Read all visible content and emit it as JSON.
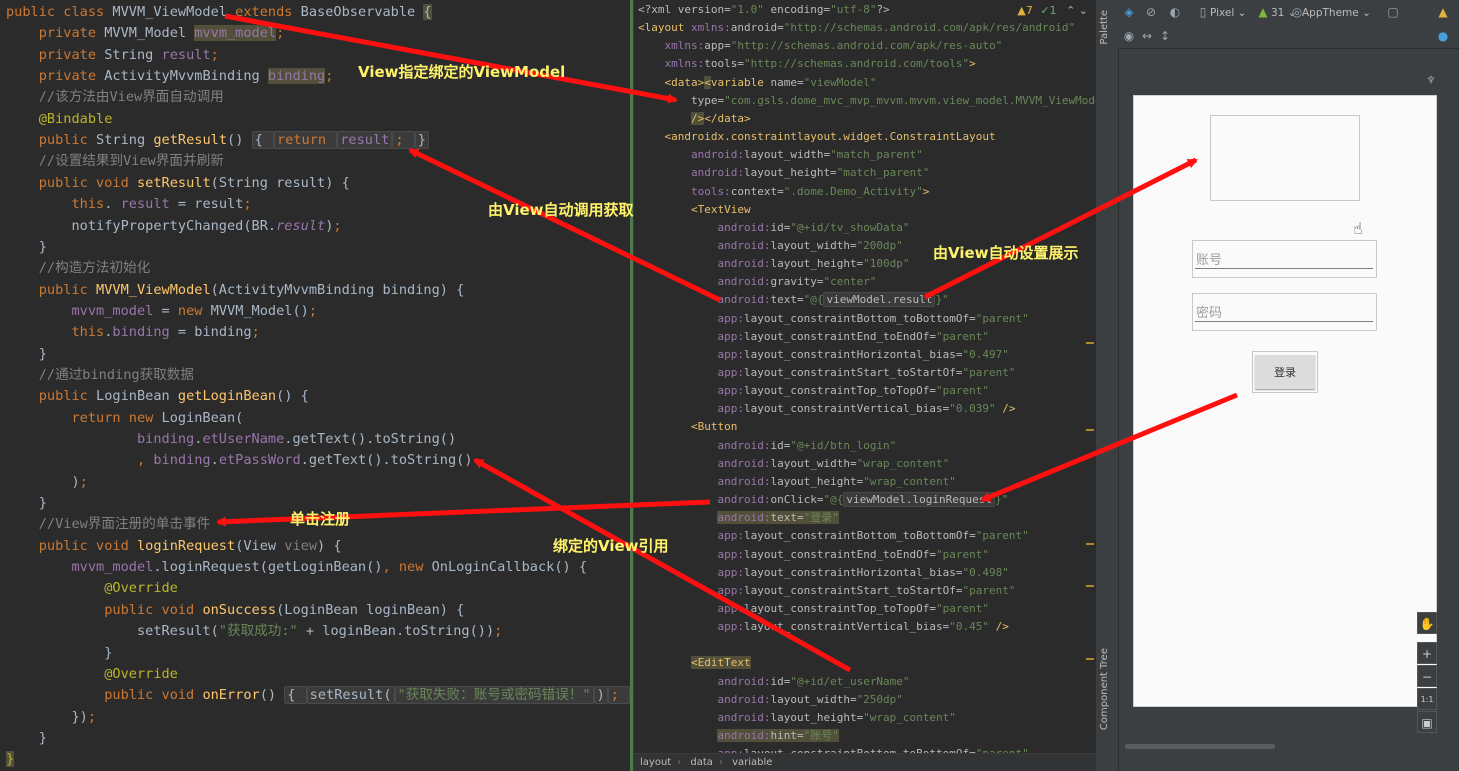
{
  "left_code": [
    [
      [
        "kw",
        "public class "
      ],
      [
        "",
        "MVVM_ViewModel "
      ],
      [
        "kw",
        "extends "
      ],
      [
        "",
        "BaseObservable "
      ],
      [
        "hly",
        "{"
      ]
    ],
    [
      [
        "",
        "    "
      ],
      [
        "kw",
        "private "
      ],
      [
        "",
        "MVVM_Model "
      ],
      [
        "fld hly",
        "mvvm_model"
      ],
      [
        "kw",
        ";"
      ]
    ],
    [
      [
        "",
        "    "
      ],
      [
        "kw",
        "private "
      ],
      [
        "",
        "String "
      ],
      [
        "fld",
        "result"
      ],
      [
        "kw",
        ";"
      ]
    ],
    [
      [
        "",
        "    "
      ],
      [
        "kw",
        "private "
      ],
      [
        "",
        "ActivityMvvmBinding "
      ],
      [
        "fld hly",
        "binding"
      ],
      [
        "kw",
        ";"
      ]
    ],
    [
      [
        "cmt",
        "    //该方法由View界面自动调用"
      ]
    ],
    [
      [
        "ann",
        "    @Bindable"
      ]
    ],
    [
      [
        "",
        "    "
      ],
      [
        "kw",
        "public "
      ],
      [
        "",
        "String "
      ],
      [
        "fn",
        "getResult"
      ],
      [
        "",
        "() "
      ],
      [
        "fold",
        "{ "
      ],
      [
        "kw fold",
        "return "
      ],
      [
        "fld fold",
        "result"
      ],
      [
        "kw fold",
        "; "
      ],
      [
        "fold",
        "}"
      ]
    ],
    [
      [
        "cmt",
        "    //设置结果到View界面并刷新"
      ]
    ],
    [
      [
        "",
        "    "
      ],
      [
        "kw",
        "public void "
      ],
      [
        "fn",
        "setResult"
      ],
      [
        "",
        "(String result) {"
      ]
    ],
    [
      [
        "",
        "        "
      ],
      [
        "kw",
        "this"
      ],
      [
        "",
        ". "
      ],
      [
        "fld",
        "result"
      ],
      [
        "",
        " = result"
      ],
      [
        "kw",
        ";"
      ]
    ],
    [
      [
        "",
        "        notifyPropertyChanged(BR."
      ],
      [
        "fld it",
        "result"
      ],
      [
        "",
        ")"
      ],
      [
        "kw",
        ";"
      ]
    ],
    [
      [
        "",
        "    }"
      ]
    ],
    [
      [
        "cmt",
        "    //构造方法初始化"
      ]
    ],
    [
      [
        "",
        "    "
      ],
      [
        "kw",
        "public "
      ],
      [
        "fn",
        "MVVM_ViewModel"
      ],
      [
        "",
        "(ActivityMvvmBinding binding) {"
      ]
    ],
    [
      [
        "",
        "        "
      ],
      [
        "fld",
        "mvvm_model"
      ],
      [
        "",
        " = "
      ],
      [
        "kw",
        "new "
      ],
      [
        "",
        "MVVM_Model()"
      ],
      [
        "kw",
        ";"
      ]
    ],
    [
      [
        "",
        "        "
      ],
      [
        "kw",
        "this"
      ],
      [
        "",
        "."
      ],
      [
        "fld",
        "binding"
      ],
      [
        "",
        " = binding"
      ],
      [
        "kw",
        ";"
      ]
    ],
    [
      [
        "",
        "    }"
      ]
    ],
    [
      [
        "cmt",
        "    //通过binding获取数据"
      ]
    ],
    [
      [
        "",
        "    "
      ],
      [
        "kw",
        "public "
      ],
      [
        "",
        "LoginBean "
      ],
      [
        "fn",
        "getLoginBean"
      ],
      [
        "",
        "() {"
      ]
    ],
    [
      [
        "",
        "        "
      ],
      [
        "kw",
        "return new "
      ],
      [
        "",
        "LoginBean("
      ]
    ],
    [
      [
        "",
        "                "
      ],
      [
        "fld",
        "binding"
      ],
      [
        "",
        "."
      ],
      [
        "fld",
        "etUserName"
      ],
      [
        "",
        ".getText().toString()"
      ]
    ],
    [
      [
        "",
        "                "
      ],
      [
        "kw",
        ", "
      ],
      [
        "fld",
        "binding"
      ],
      [
        "",
        "."
      ],
      [
        "fld",
        "etPassWord"
      ],
      [
        "",
        ".getText().toString()"
      ]
    ],
    [
      [
        "",
        "        )"
      ],
      [
        "kw",
        ";"
      ]
    ],
    [
      [
        "",
        "    }"
      ]
    ],
    [
      [
        "cmt",
        "    //View界面注册的单击事件"
      ]
    ],
    [
      [
        "",
        "    "
      ],
      [
        "kw",
        "public void "
      ],
      [
        "fn",
        "loginRequest"
      ],
      [
        "",
        "(View "
      ],
      [
        "cmt",
        "view"
      ],
      [
        "",
        ") {"
      ]
    ],
    [
      [
        "",
        "        "
      ],
      [
        "fld",
        "mvvm_model"
      ],
      [
        "",
        ".loginRequest(getLoginBean()"
      ],
      [
        "kw",
        ", new "
      ],
      [
        "",
        "OnLoginCallback() {"
      ]
    ],
    [
      [
        "ann",
        "            @Override"
      ]
    ],
    [
      [
        "",
        "            "
      ],
      [
        "kw",
        "public void "
      ],
      [
        "fn",
        "onSuccess"
      ],
      [
        "",
        "(LoginBean loginBean) {"
      ]
    ],
    [
      [
        "",
        "                setResult("
      ],
      [
        "str",
        "\"获取成功:\""
      ],
      [
        "",
        " + loginBean.toString())"
      ],
      [
        "kw",
        ";"
      ]
    ],
    [
      [
        "",
        "            }"
      ]
    ],
    [
      [
        "ann",
        "            @Override"
      ]
    ],
    [
      [
        "",
        "            "
      ],
      [
        "kw",
        "public void "
      ],
      [
        "fn",
        "onError"
      ],
      [
        "",
        "() "
      ],
      [
        "fold",
        "{ "
      ],
      [
        "fold",
        "setResult("
      ],
      [
        "str fold",
        "\"获取失败：账号或密码错误！\""
      ],
      [
        "fold",
        ")"
      ],
      [
        "kw fold",
        "; "
      ],
      [
        "fold",
        "}"
      ]
    ],
    [
      [
        "",
        "        })"
      ],
      [
        "kw",
        ";"
      ]
    ],
    [
      [
        "",
        "    }"
      ]
    ],
    [
      [
        "ann hly",
        "}"
      ]
    ]
  ],
  "right_code": [
    [
      [
        "attr",
        "<?xml version="
      ],
      [
        "xstr",
        "\"1.0\""
      ],
      [
        "attr",
        " encoding="
      ],
      [
        "xstr",
        "\"utf-8\""
      ],
      [
        "attr",
        "?>"
      ]
    ],
    [
      [
        "tag",
        "<layout "
      ],
      [
        "ns",
        "xmlns:"
      ],
      [
        "attr",
        "android="
      ],
      [
        "xstr",
        "\"http://schemas.android.com/apk/res/android\""
      ]
    ],
    [
      [
        "",
        "    "
      ],
      [
        "ns",
        "xmlns:"
      ],
      [
        "attr",
        "app="
      ],
      [
        "xstr",
        "\"http://schemas.android.com/apk/res-auto\""
      ]
    ],
    [
      [
        "",
        "    "
      ],
      [
        "ns",
        "xmlns:"
      ],
      [
        "attr",
        "tools="
      ],
      [
        "xstr",
        "\"http://schemas.android.com/tools\""
      ],
      [
        "tag",
        ">"
      ]
    ],
    [
      [
        "",
        "    "
      ],
      [
        "tag",
        "<data>"
      ],
      [
        "tag hly",
        "<"
      ],
      [
        "tag",
        "variable "
      ],
      [
        "attr",
        "name="
      ],
      [
        "xstr",
        "\"viewModel\""
      ]
    ],
    [
      [
        "",
        "        "
      ],
      [
        "attr",
        "type="
      ],
      [
        "xstr",
        "\"com.gsls.dome_mvc_mvp_mvvm.mvvm.view_model.MVVM_ViewModel\""
      ]
    ],
    [
      [
        "",
        "        "
      ],
      [
        "tag hly",
        "/>"
      ],
      [
        "tag",
        "</data>"
      ]
    ],
    [
      [
        "",
        "    "
      ],
      [
        "tag",
        "<androidx.constraintlayout.widget.ConstraintLayout"
      ]
    ],
    [
      [
        "",
        "        "
      ],
      [
        "ns",
        "android:"
      ],
      [
        "attr",
        "layout_width="
      ],
      [
        "xstr",
        "\"match_parent\""
      ]
    ],
    [
      [
        "",
        "        "
      ],
      [
        "ns",
        "android:"
      ],
      [
        "attr",
        "layout_height="
      ],
      [
        "xstr",
        "\"match_parent\""
      ]
    ],
    [
      [
        "",
        "        "
      ],
      [
        "ns",
        "tools:"
      ],
      [
        "attr",
        "context="
      ],
      [
        "xstr",
        "\".dome.Demo_Activity\""
      ],
      [
        "tag",
        ">"
      ]
    ],
    [
      [
        "",
        "        "
      ],
      [
        "tag",
        "<TextView"
      ]
    ],
    [
      [
        "",
        "            "
      ],
      [
        "ns",
        "android:"
      ],
      [
        "attr",
        "id="
      ],
      [
        "xstr",
        "\"@+id/tv_showData\""
      ]
    ],
    [
      [
        "",
        "            "
      ],
      [
        "ns",
        "android:"
      ],
      [
        "attr",
        "layout_width="
      ],
      [
        "xstr",
        "\"200dp\""
      ]
    ],
    [
      [
        "",
        "            "
      ],
      [
        "ns",
        "android:"
      ],
      [
        "attr",
        "layout_height="
      ],
      [
        "xstr",
        "\"100dp\""
      ]
    ],
    [
      [
        "",
        "            "
      ],
      [
        "ns",
        "android:"
      ],
      [
        "attr",
        "gravity="
      ],
      [
        "xstr",
        "\"center\""
      ]
    ],
    [
      [
        "",
        "            "
      ],
      [
        "ns",
        "android:"
      ],
      [
        "attr",
        "text="
      ],
      [
        "xstr",
        "\"@{"
      ],
      [
        "attr fold",
        "viewModel.result"
      ],
      [
        "xstr",
        "}\""
      ]
    ],
    [
      [
        "",
        "            "
      ],
      [
        "ns",
        "app:"
      ],
      [
        "attr",
        "layout_constraintBottom_toBottomOf="
      ],
      [
        "xstr",
        "\"parent\""
      ]
    ],
    [
      [
        "",
        "            "
      ],
      [
        "ns",
        "app:"
      ],
      [
        "attr",
        "layout_constraintEnd_toEndOf="
      ],
      [
        "xstr",
        "\"parent\""
      ]
    ],
    [
      [
        "",
        "            "
      ],
      [
        "ns",
        "app:"
      ],
      [
        "attr",
        "layout_constraintHorizontal_bias="
      ],
      [
        "xstr",
        "\"0.497\""
      ]
    ],
    [
      [
        "",
        "            "
      ],
      [
        "ns",
        "app:"
      ],
      [
        "attr",
        "layout_constraintStart_toStartOf="
      ],
      [
        "xstr",
        "\"parent\""
      ]
    ],
    [
      [
        "",
        "            "
      ],
      [
        "ns",
        "app:"
      ],
      [
        "attr",
        "layout_constraintTop_toTopOf="
      ],
      [
        "xstr",
        "\"parent\""
      ]
    ],
    [
      [
        "",
        "            "
      ],
      [
        "ns",
        "app:"
      ],
      [
        "attr",
        "layout_constraintVertical_bias="
      ],
      [
        "xstr",
        "\"0.039\""
      ],
      [
        "tag",
        " />"
      ]
    ],
    [
      [
        "",
        "        "
      ],
      [
        "tag",
        "<Button"
      ]
    ],
    [
      [
        "",
        "            "
      ],
      [
        "ns",
        "android:"
      ],
      [
        "attr",
        "id="
      ],
      [
        "xstr",
        "\"@+id/btn_login\""
      ]
    ],
    [
      [
        "",
        "            "
      ],
      [
        "ns",
        "android:"
      ],
      [
        "attr",
        "layout_width="
      ],
      [
        "xstr",
        "\"wrap_content\""
      ]
    ],
    [
      [
        "",
        "            "
      ],
      [
        "ns",
        "android:"
      ],
      [
        "attr",
        "layout_height="
      ],
      [
        "xstr",
        "\"wrap_content\""
      ]
    ],
    [
      [
        "",
        "            "
      ],
      [
        "ns",
        "android:"
      ],
      [
        "attr",
        "onClick="
      ],
      [
        "xstr",
        "\"@{"
      ],
      [
        "attr fold",
        "viewModel.loginRequest"
      ],
      [
        "xstr",
        "}\""
      ]
    ],
    [
      [
        "",
        "            "
      ],
      [
        "ns hly",
        "android:"
      ],
      [
        "attr hly",
        "text="
      ],
      [
        "xstr hly",
        "\"登录\""
      ]
    ],
    [
      [
        "",
        "            "
      ],
      [
        "ns",
        "app:"
      ],
      [
        "attr",
        "layout_constraintBottom_toBottomOf="
      ],
      [
        "xstr",
        "\"parent\""
      ]
    ],
    [
      [
        "",
        "            "
      ],
      [
        "ns",
        "app:"
      ],
      [
        "attr",
        "layout_constraintEnd_toEndOf="
      ],
      [
        "xstr",
        "\"parent\""
      ]
    ],
    [
      [
        "",
        "            "
      ],
      [
        "ns",
        "app:"
      ],
      [
        "attr",
        "layout_constraintHorizontal_bias="
      ],
      [
        "xstr",
        "\"0.498\""
      ]
    ],
    [
      [
        "",
        "            "
      ],
      [
        "ns",
        "app:"
      ],
      [
        "attr",
        "layout_constraintStart_toStartOf="
      ],
      [
        "xstr",
        "\"parent\""
      ]
    ],
    [
      [
        "",
        "            "
      ],
      [
        "ns",
        "app:"
      ],
      [
        "attr",
        "layout_constraintTop_toTopOf="
      ],
      [
        "xstr",
        "\"parent\""
      ]
    ],
    [
      [
        "",
        "            "
      ],
      [
        "ns",
        "app:"
      ],
      [
        "attr",
        "layout_constraintVertical_bias="
      ],
      [
        "xstr",
        "\"0.45\""
      ],
      [
        "tag",
        " />"
      ]
    ],
    [
      [
        "",
        ""
      ]
    ],
    [
      [
        "",
        "        "
      ],
      [
        "tag hly",
        "<EditText"
      ]
    ],
    [
      [
        "",
        "            "
      ],
      [
        "ns",
        "android:"
      ],
      [
        "attr",
        "id="
      ],
      [
        "xstr",
        "\"@+id/et_userName\""
      ]
    ],
    [
      [
        "",
        "            "
      ],
      [
        "ns",
        "android:"
      ],
      [
        "attr",
        "layout_width="
      ],
      [
        "xstr",
        "\"250dp\""
      ]
    ],
    [
      [
        "",
        "            "
      ],
      [
        "ns",
        "android:"
      ],
      [
        "attr",
        "layout_height="
      ],
      [
        "xstr",
        "\"wrap_content\""
      ]
    ],
    [
      [
        "",
        "            "
      ],
      [
        "ns hly",
        "android:"
      ],
      [
        "attr hly",
        "hint="
      ],
      [
        "xstr hly",
        "\"账号\""
      ]
    ],
    [
      [
        "",
        "            "
      ],
      [
        "ns",
        "app:"
      ],
      [
        "attr",
        "layout_constraintBottom_toBottomOf="
      ],
      [
        "xstr",
        "\"parent\""
      ]
    ]
  ],
  "inspection": {
    "warnings": "▲7",
    "checks": "✓1",
    "nav": "⌃ ⌄"
  },
  "breadcrumb": [
    "layout",
    "data",
    "variable"
  ],
  "preview_toolbar": {
    "device": "Pixel ⌄",
    "api": "31 ⌄",
    "theme": "AppTheme ⌄"
  },
  "side_tabs": {
    "palette": "Palette",
    "component_tree": "Component Tree"
  },
  "preview": {
    "username_hint": "账号",
    "password_hint": "密码",
    "login_label": "登录",
    "zoom_in": "+",
    "zoom_out": "−",
    "zoom_actual": "1:1"
  },
  "callouts": {
    "c1": "View指定绑定的ViewModel",
    "c2": "由View自动调用获取",
    "c3": "由View自动设置展示",
    "c4": "单击注册",
    "c5": "绑定的View引用"
  },
  "arrow_color": "#ff1010",
  "callout_color": "#fff36b"
}
